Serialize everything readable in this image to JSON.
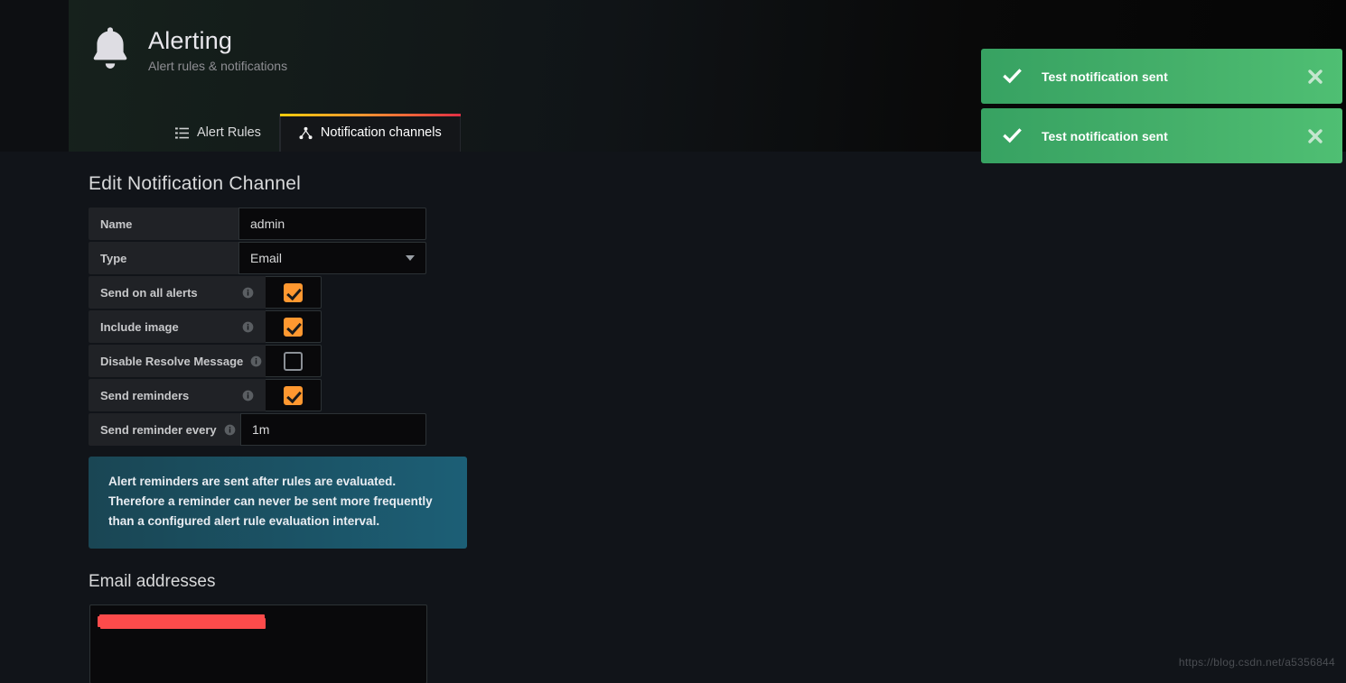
{
  "header": {
    "icon": "bell-icon",
    "title": "Alerting",
    "subtitle": "Alert rules & notifications"
  },
  "tabs": [
    {
      "label": "Alert Rules",
      "icon": "list-icon",
      "active": false
    },
    {
      "label": "Notification channels",
      "icon": "sitemap-icon",
      "active": true
    }
  ],
  "main": {
    "section_title": "Edit Notification Channel",
    "fields": {
      "name": {
        "label": "Name",
        "value": "admin"
      },
      "type": {
        "label": "Type",
        "value": "Email"
      },
      "send_on_all_alerts": {
        "label": "Send on all alerts",
        "checked": true
      },
      "include_image": {
        "label": "Include image",
        "checked": true
      },
      "disable_resolve_message": {
        "label": "Disable Resolve Message",
        "checked": false
      },
      "send_reminders": {
        "label": "Send reminders",
        "checked": true
      },
      "send_reminder_every": {
        "label": "Send reminder every",
        "value": "1m"
      }
    },
    "alert_box": "Alert reminders are sent after rules are evaluated. Therefore a reminder can never be sent more frequently than a configured alert rule evaluation interval.",
    "email_section": {
      "title": "Email addresses",
      "value": ""
    }
  },
  "toasts": [
    {
      "message": "Test notification sent",
      "icon": "check-icon",
      "close_icon": "close-icon"
    },
    {
      "message": "Test notification sent",
      "icon": "check-icon",
      "close_icon": "close-icon"
    }
  ],
  "watermark": "https://blog.csdn.net/a5356844",
  "colors": {
    "accent_orange": "#ff9830",
    "tab_gradient_start": "#f2cc0c",
    "tab_gradient_end": "#e02f44",
    "toast_green": "#45b06a",
    "info_box_blue": "#1b5467",
    "redaction_red": "#fd4b4b",
    "page_bg": "#111419"
  }
}
